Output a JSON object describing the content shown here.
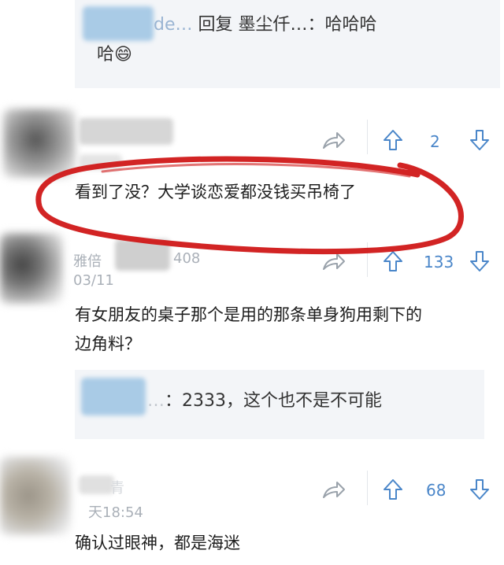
{
  "comments": [
    {
      "reply": {
        "prefix": "de…",
        "text": " 回复 墨尘仟…：哈哈哈",
        "text2": "哈",
        "emoji": "😄"
      }
    },
    {
      "actions": {
        "share_icon": "share-icon",
        "up_icon": "arrow-up-icon",
        "count": "2",
        "down_icon": "arrow-down-icon"
      },
      "text": "看到了没？大学谈恋爱都没钱买吊椅了",
      "annotation_color": "#d01818"
    },
    {
      "meta": {
        "name_fragment": "雅倍",
        "id_fragment": "408",
        "date_fragment": "03/11"
      },
      "actions": {
        "count": "133"
      },
      "text_line1": "有女朋友的桌子那个是用的那条单身狗用剩下的",
      "text_line2": "边角料？",
      "reply": {
        "prefix": "…",
        "text": "：2333，这个也不是不可能"
      }
    },
    {
      "meta": {
        "name_fragment": "青",
        "time_fragment": "天18:54"
      },
      "actions": {
        "count": "68"
      },
      "text": "确认过眼神，都是海迷"
    }
  ],
  "colors": {
    "accent": "#4a86c9",
    "reply_bg": "#f3f5f8",
    "annotation": "#d01818"
  }
}
